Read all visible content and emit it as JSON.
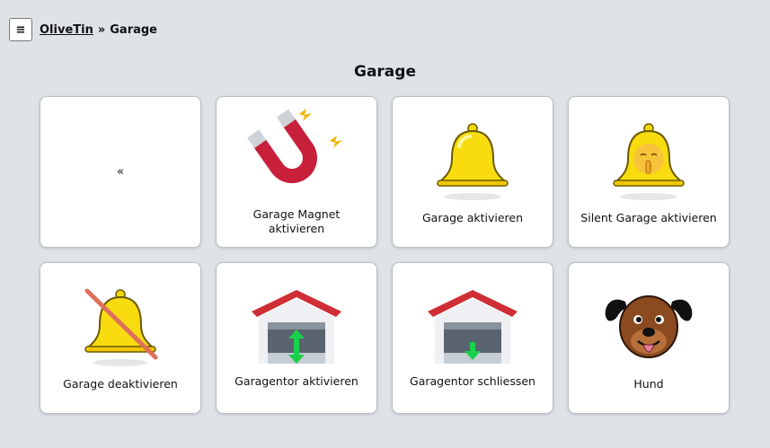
{
  "header": {
    "menu_icon": "≡",
    "app_name": "OliveTin",
    "separator": "»",
    "current": "Garage"
  },
  "page": {
    "title": "Garage"
  },
  "actions": [
    {
      "label": "«",
      "icon": "none"
    },
    {
      "label": "Garage Magnet aktivieren",
      "icon": "magnet-icon"
    },
    {
      "label": "Garage aktivieren",
      "icon": "bell-icon"
    },
    {
      "label": "Silent Garage aktivieren",
      "icon": "shushing-bell-icon"
    },
    {
      "label": "Garage deaktivieren",
      "icon": "bell-off-icon"
    },
    {
      "label": "Garagentor aktivieren",
      "icon": "garage-updown-icon"
    },
    {
      "label": "Garagentor schliessen",
      "icon": "garage-close-icon"
    },
    {
      "label": "Hund",
      "icon": "dog-icon"
    }
  ]
}
